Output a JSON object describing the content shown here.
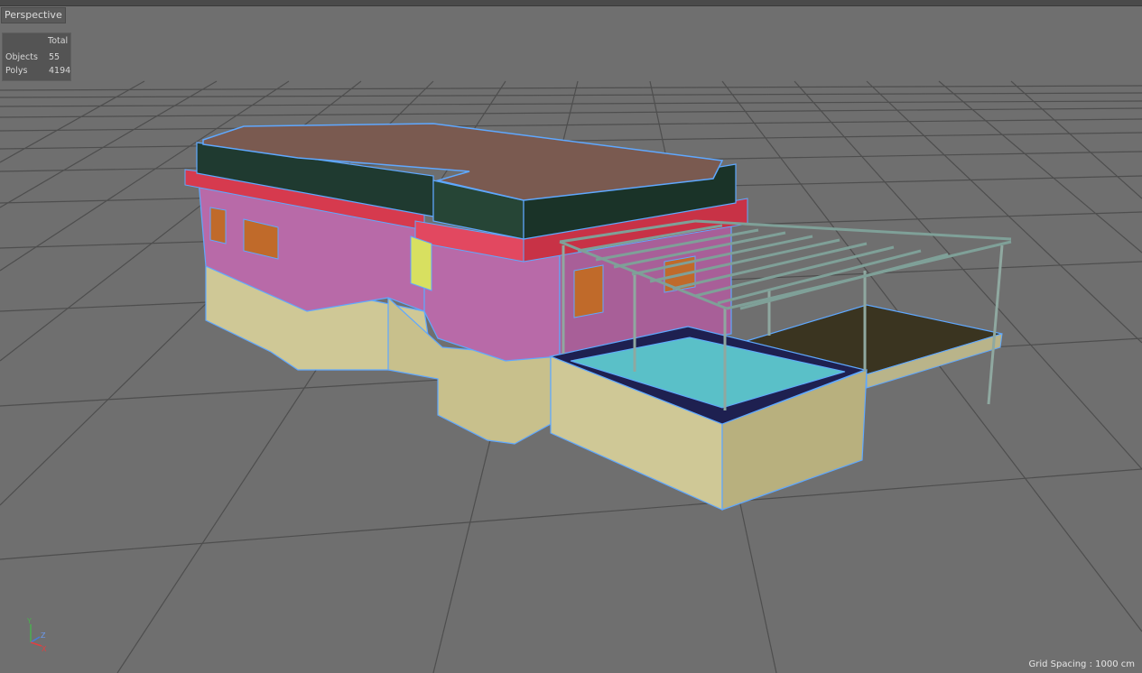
{
  "viewport": {
    "camera_label": "Perspective",
    "grid_spacing": "Grid Spacing : 1000 cm"
  },
  "stats": {
    "header": "Total",
    "objects_label": "Objects",
    "objects_value": "55",
    "polys_label": "Polys",
    "polys_value": "4194"
  },
  "axis": {
    "y": "Y",
    "z": "Z",
    "x": "X"
  },
  "colors": {
    "background": "#6f6f6f",
    "roof": "#7a5a50",
    "parapet": "#1f3a30",
    "band": "#d63a4e",
    "upper_wall": "#b86aa8",
    "lower_wall": "#cfc896",
    "window": "#c06a2a",
    "pool_water": "#5ac0c8",
    "deck": "#3a3420",
    "wire": "#5fa8ff"
  }
}
